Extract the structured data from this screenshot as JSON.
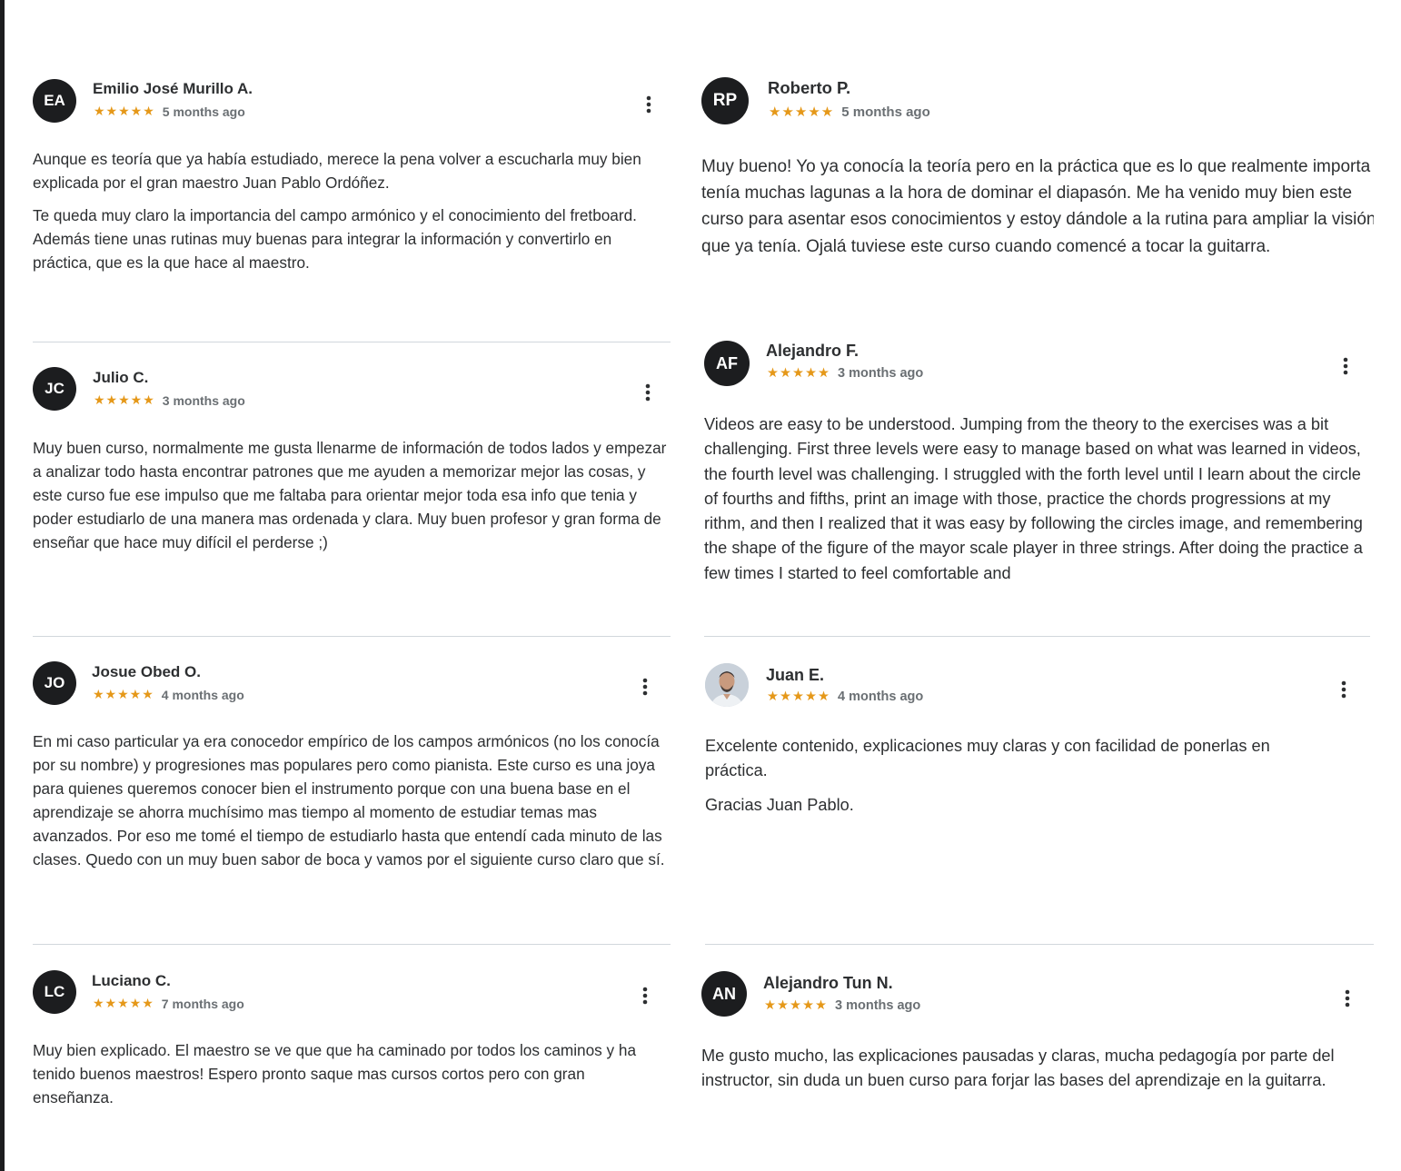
{
  "reviews": [
    {
      "initials": "EA",
      "name": "Emilio José Murillo A.",
      "stars": "★★★★★",
      "time": "5 months ago",
      "paragraphs": [
        "Aunque es teoría que ya había estudiado, merece la pena volver a escucharla muy bien explicada por el gran maestro Juan Pablo Ordóñez.",
        "Te queda muy claro la importancia del campo armónico y el conocimiento del fretboard. Además tiene unas rutinas muy buenas para integrar la información y convertirlo en práctica, que es la que hace al maestro."
      ]
    },
    {
      "initials": "RP",
      "name": "Roberto P.",
      "stars": "★★★★★",
      "time": "5 months ago",
      "paragraphs": [
        "Muy bueno! Yo ya conocía la teoría pero en la práctica que es lo que realmente importa tenía muchas lagunas a la hora de dominar el diapasón. Me ha venido muy bien este curso para asentar esos conocimientos y estoy dándole a la rutina para ampliar la visión que ya tenía. Ojalá tuviese este curso cuando comencé a tocar la guitarra."
      ]
    },
    {
      "initials": "JC",
      "name": "Julio C.",
      "stars": "★★★★★",
      "time": "3 months ago",
      "paragraphs": [
        "Muy buen curso, normalmente me gusta llenarme de información de todos lados y empezar a analizar todo hasta encontrar patrones que me ayuden a memorizar mejor las cosas, y este curso fue ese impulso que me faltaba para orientar mejor toda esa info que tenia y poder estudiarlo de una manera mas ordenada y clara. Muy buen profesor y gran forma de enseñar que hace muy difícil el perderse ;)"
      ]
    },
    {
      "initials": "AF",
      "name": "Alejandro F.",
      "stars": "★★★★★",
      "time": "3 months ago",
      "paragraphs": [
        "Videos are easy to be understood. Jumping from the theory to the exercises was a bit challenging. First three levels were easy to manage based on what was learned in videos, the fourth level was challenging. I struggled with the forth level until I learn about the circle of fourths and fifths, print an image with those, practice the chords progressions at my rithm, and then I realized that it was easy by following the circles image, and remembering the shape of the figure of the mayor scale player in three strings. After doing the practice a few times I started to feel comfortable and"
      ]
    },
    {
      "initials": "JO",
      "name": "Josue Obed O.",
      "stars": "★★★★★",
      "time": "4 months ago",
      "paragraphs": [
        "En mi caso particular ya era conocedor empírico de los campos armónicos (no los conocía por su nombre) y progresiones mas populares pero como pianista. Este curso es una joya para quienes queremos conocer bien el instrumento porque con una buena base en el aprendizaje se ahorra muchísimo mas tiempo al momento de estudiar temas mas avanzados. Por eso me tomé el tiempo de estudiarlo hasta que entendí cada minuto de las clases. Quedo con un muy buen sabor de boca y vamos por el siguiente curso claro que sí."
      ]
    },
    {
      "initials": "",
      "name": "Juan E.",
      "stars": "★★★★★",
      "time": "4 months ago",
      "paragraphs": [
        "Excelente contenido, explicaciones muy claras y con facilidad de ponerlas en práctica.",
        "Gracias Juan Pablo."
      ]
    },
    {
      "initials": "LC",
      "name": "Luciano C.",
      "stars": "★★★★★",
      "time": "7 months ago",
      "paragraphs": [
        "Muy bien explicado. El maestro se ve que que ha caminado por todos los caminos y ha tenido buenos maestros! Espero pronto saque mas cursos cortos pero con gran enseñanza."
      ]
    },
    {
      "initials": "AN",
      "name": "Alejandro Tun N.",
      "stars": "★★★★★",
      "time": "3 months ago",
      "paragraphs": [
        "Me gusto mucho, las explicaciones pausadas y claras, mucha pedagogía por parte del instructor, sin duda un buen curso para forjar las bases del aprendizaje en la guitarra."
      ]
    }
  ],
  "colors": {
    "avatar_bg": "#1c1d1f",
    "star": "#e59819",
    "divider": "#d1d7dc",
    "text": "#2d2f31",
    "muted": "#6a6f73"
  },
  "icons": {
    "menu": "kebab-vertical-icon",
    "star": "star-icon"
  }
}
